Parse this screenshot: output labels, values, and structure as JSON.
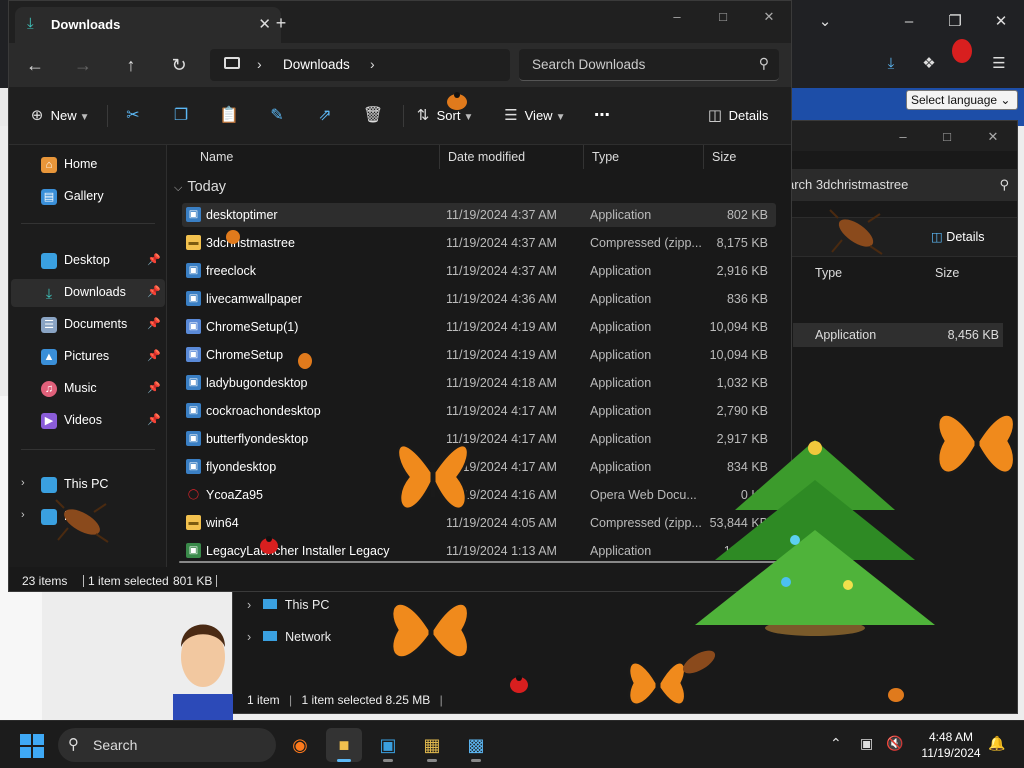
{
  "browser": {
    "language_select": "Select language"
  },
  "window2": {
    "search_placeholder": "arch 3dchristmastree",
    "details_label": "Details",
    "columns": [
      "Type",
      "Size"
    ],
    "selected_row": {
      "type": "Application",
      "size": "8,456 KB"
    },
    "nav": [
      {
        "label": "This PC"
      },
      {
        "label": "Network"
      }
    ],
    "status": {
      "items": "1 item",
      "selected": "1 item selected  8.25 MB"
    }
  },
  "explorer": {
    "tab_title": "Downloads",
    "address": {
      "crumb": "Downloads"
    },
    "search_placeholder": "Search Downloads",
    "commands": {
      "new": "New",
      "sort": "Sort",
      "view": "View",
      "details": "Details"
    },
    "nav": [
      {
        "label": "Home"
      },
      {
        "label": "Gallery"
      },
      {
        "label": "Desktop"
      },
      {
        "label": "Downloads"
      },
      {
        "label": "Documents"
      },
      {
        "label": "Pictures"
      },
      {
        "label": "Music"
      },
      {
        "label": "Videos"
      },
      {
        "label": "This PC"
      },
      {
        "label": "N"
      }
    ],
    "columns": [
      "Name",
      "Date modified",
      "Type",
      "Size"
    ],
    "group": "Today",
    "files": [
      {
        "name": "desktoptimer",
        "date": "11/19/2024 4:37 AM",
        "type": "Application",
        "size": "802 KB",
        "kind": "app"
      },
      {
        "name": "3dchristmastree",
        "date": "11/19/2024 4:37 AM",
        "type": "Compressed (zipp...",
        "size": "8,175 KB",
        "kind": "zip"
      },
      {
        "name": "freeclock",
        "date": "11/19/2024 4:37 AM",
        "type": "Application",
        "size": "2,916 KB",
        "kind": "app"
      },
      {
        "name": "livecamwallpaper",
        "date": "11/19/2024 4:36 AM",
        "type": "Application",
        "size": "836 KB",
        "kind": "app"
      },
      {
        "name": "ChromeSetup(1)",
        "date": "11/19/2024 4:19 AM",
        "type": "Application",
        "size": "10,094 KB",
        "kind": "setup"
      },
      {
        "name": "ChromeSetup",
        "date": "11/19/2024 4:19 AM",
        "type": "Application",
        "size": "10,094 KB",
        "kind": "setup"
      },
      {
        "name": "ladybugondesktop",
        "date": "11/19/2024 4:18 AM",
        "type": "Application",
        "size": "1,032 KB",
        "kind": "app"
      },
      {
        "name": "cockroachondesktop",
        "date": "11/19/2024 4:17 AM",
        "type": "Application",
        "size": "2,790 KB",
        "kind": "app"
      },
      {
        "name": "butterflyondesktop",
        "date": "11/19/2024 4:17 AM",
        "type": "Application",
        "size": "2,917 KB",
        "kind": "app"
      },
      {
        "name": "flyondesktop",
        "date": "11/19/2024 4:17 AM",
        "type": "Application",
        "size": "834 KB",
        "kind": "app"
      },
      {
        "name": "YcoaZa95",
        "date": "11/19/2024 4:16 AM",
        "type": "Opera Web Docu...",
        "size": "0 KB",
        "kind": "opera"
      },
      {
        "name": "win64",
        "date": "11/19/2024 4:05 AM",
        "type": "Compressed (zipp...",
        "size": "53,844 KB",
        "kind": "zip"
      },
      {
        "name": "LegacyLauncher Installer Legacy",
        "date": "11/19/2024 1:13 AM",
        "type": "Application",
        "size": "114,997",
        "kind": "legacy"
      }
    ],
    "status": {
      "count": "23 items",
      "selected": "1 item selected",
      "size": "801 KB"
    }
  },
  "taskbar": {
    "search_label": "Search",
    "time": "4:48 AM",
    "date": "11/19/2024"
  },
  "colors": {
    "accent": "#5cb8f5",
    "window_bg": "#191919",
    "selection": "#2d2d2d",
    "folder": "#f2c14e",
    "opera": "#e0242b"
  }
}
